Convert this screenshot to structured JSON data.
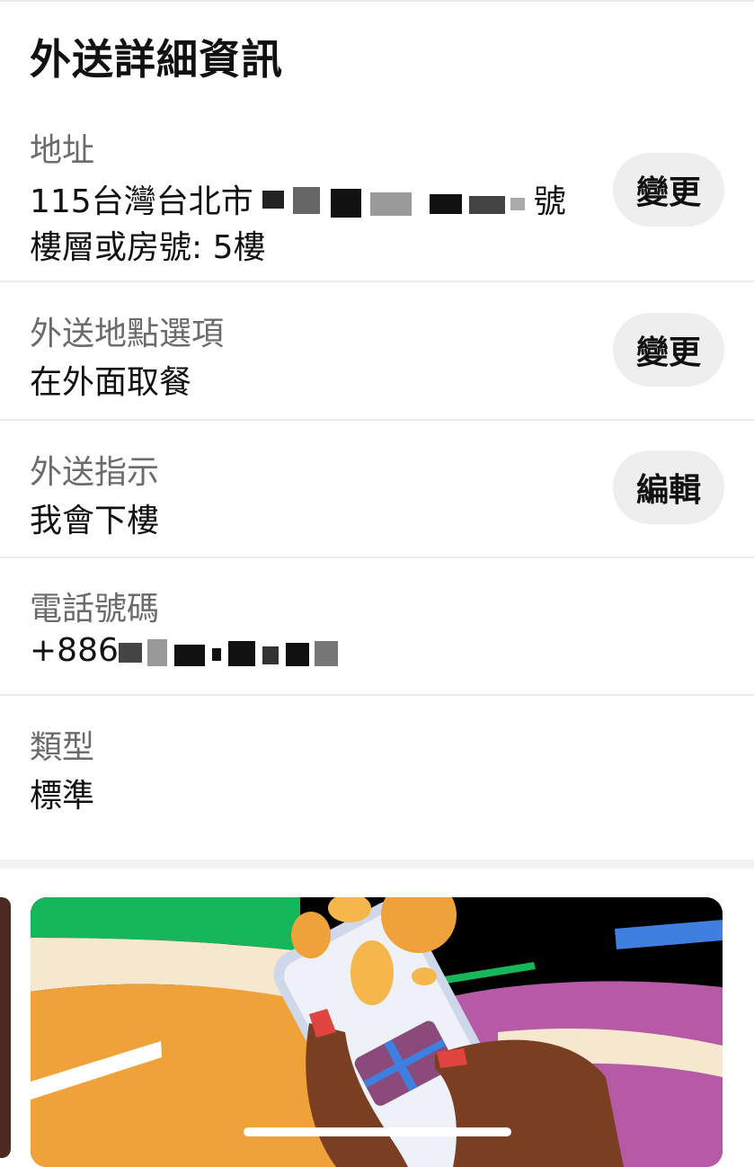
{
  "header": {
    "title": "外送詳細資訊"
  },
  "address": {
    "label": "地址",
    "line1_prefix": "115台灣台北市",
    "line1_suffix": "號",
    "line2": "樓層或房號: 5樓",
    "button": "變更"
  },
  "dropoff": {
    "label": "外送地點選項",
    "value": "在外面取餐",
    "button": "變更"
  },
  "instructions": {
    "label": "外送指示",
    "value": "我會下樓",
    "button": "編輯"
  },
  "phone": {
    "label": "電話號碼",
    "value_prefix": "+886"
  },
  "type": {
    "label": "類型",
    "value": "標準"
  },
  "colors": {
    "label_gray": "#6b6b6b",
    "pill_bg": "#eeeeee",
    "promo_green": "#16b75a",
    "promo_orange": "#f0a23a",
    "promo_purple": "#b65aa6",
    "promo_blue": "#3f7fe0"
  },
  "icons": [
    "phone-with-coins-illustration"
  ]
}
